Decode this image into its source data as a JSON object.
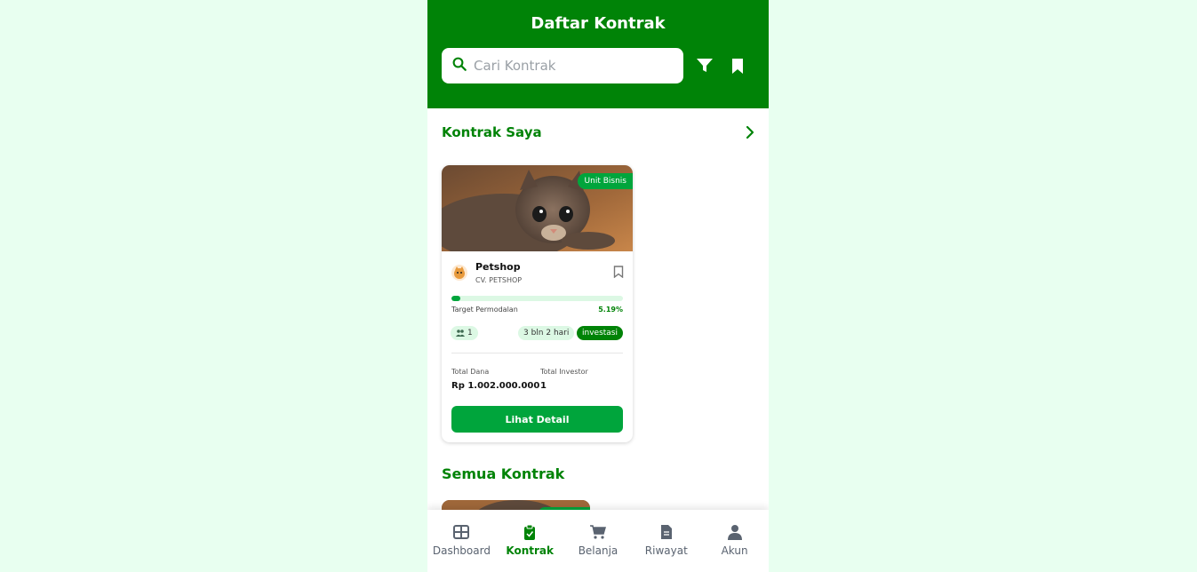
{
  "header": {
    "title": "Daftar Kontrak",
    "search_placeholder": "Cari Kontrak"
  },
  "icons": {
    "search": "search-icon",
    "filter": "filter-icon",
    "bookmark": "bookmark-icon",
    "arrow": "chevron-right-icon"
  },
  "sections": {
    "my_contracts": "Kontrak Saya",
    "all_contracts": "Semua Kontrak"
  },
  "card": {
    "badge": "Unit Bisnis",
    "name": "Petshop",
    "company": "CV. PETSHOP",
    "progress_percent": 5.19,
    "target_label": "Target Permodalan",
    "target_pct": "5.19%",
    "investor_count": "1",
    "duration": "3 bln 2 hari",
    "status": "investasi",
    "total_dana_label": "Total Dana",
    "total_dana": "Rp 1.002.000.000",
    "total_investor_label": "Total Investor",
    "total_investor": "1",
    "detail_button": "Lihat Detail"
  },
  "nav": {
    "items": [
      {
        "label": "Dashboard",
        "icon": "dashboard-icon"
      },
      {
        "label": "Kontrak",
        "icon": "clipboard-icon"
      },
      {
        "label": "Belanja",
        "icon": "cart-icon"
      },
      {
        "label": "Riwayat",
        "icon": "document-icon"
      },
      {
        "label": "Akun",
        "icon": "user-icon"
      }
    ]
  },
  "colors": {
    "primary": "#008307",
    "accent": "#00a53c",
    "background": "#e8fff0"
  }
}
